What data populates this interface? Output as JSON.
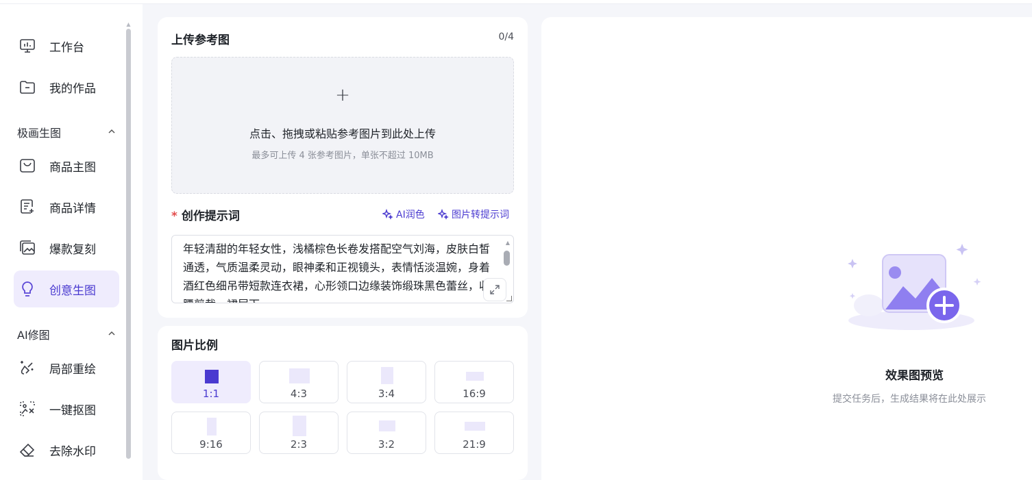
{
  "sidebar": {
    "items": [
      {
        "label": "工作台",
        "icon": "monitor-icon"
      },
      {
        "label": "我的作品",
        "icon": "folder-icon"
      }
    ],
    "groups": [
      {
        "title": "极画生图",
        "items": [
          {
            "label": "商品主图",
            "icon": "shopping-bag-icon"
          },
          {
            "label": "商品详情",
            "icon": "detail-doc-icon"
          },
          {
            "label": "爆款复刻",
            "icon": "gallery-copy-icon"
          },
          {
            "label": "创意生图",
            "icon": "lightbulb-icon",
            "active": true
          }
        ]
      },
      {
        "title": "AI修图",
        "items": [
          {
            "label": "局部重绘",
            "icon": "magic-brush-icon"
          },
          {
            "label": "一键抠图",
            "icon": "cutout-icon"
          },
          {
            "label": "去除水印",
            "icon": "eraser-icon"
          }
        ]
      }
    ]
  },
  "upload": {
    "title": "上传参考图",
    "counter": "0/4",
    "main_text": "点击、拖拽或粘贴参考图片到此处上传",
    "sub_text": "最多可上传 4 张参考图片，单张不超过 10MB",
    "plus": "+"
  },
  "prompt": {
    "required_mark": "*",
    "title": "创作提示词",
    "ai_polish": "AI润色",
    "image_to_prompt": "图片转提示词",
    "text": "年轻清甜的年轻女性，浅橘棕色长卷发搭配空气刘海，皮肤白皙通透，气质温柔灵动，眼神柔和正视镜头，表情恬淡温婉，身着酒红色细吊带短款连衣裙，心形领口边缘装饰缎珠黑色蕾丝，收腰剪裁，裙层下"
  },
  "ratio": {
    "title": "图片比例",
    "options": [
      "1:1",
      "4:3",
      "3:4",
      "16:9",
      "9:16",
      "2:3",
      "3:2",
      "21:9"
    ],
    "selected": "1:1"
  },
  "preview": {
    "title": "效果图预览",
    "subtitle": "提交任务后，生成结果将在此处展示"
  },
  "colors": {
    "accent": "#4a3ad0",
    "accent_soft": "#efecfd",
    "required": "#e34d4d"
  }
}
